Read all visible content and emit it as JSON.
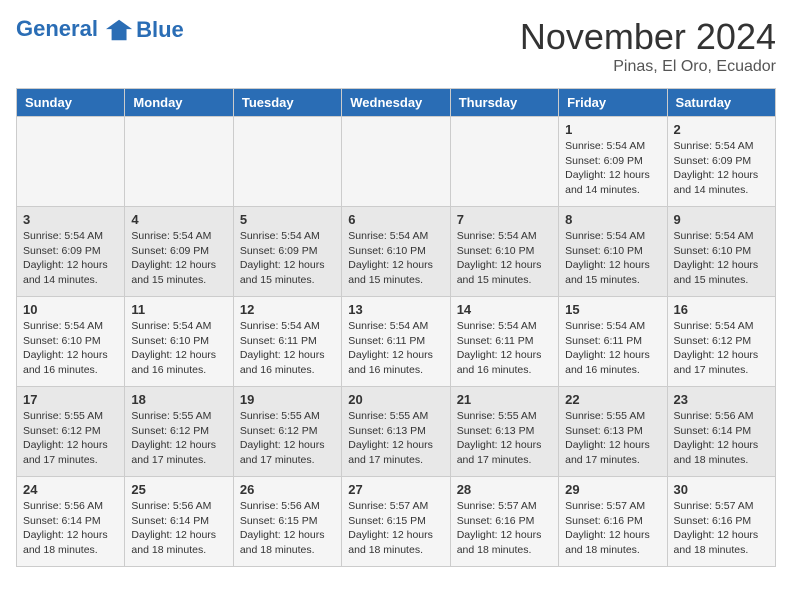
{
  "header": {
    "logo_line1": "General",
    "logo_line2": "Blue",
    "month": "November 2024",
    "location": "Pinas, El Oro, Ecuador"
  },
  "days_of_week": [
    "Sunday",
    "Monday",
    "Tuesday",
    "Wednesday",
    "Thursday",
    "Friday",
    "Saturday"
  ],
  "weeks": [
    [
      {
        "day": "",
        "info": ""
      },
      {
        "day": "",
        "info": ""
      },
      {
        "day": "",
        "info": ""
      },
      {
        "day": "",
        "info": ""
      },
      {
        "day": "",
        "info": ""
      },
      {
        "day": "1",
        "info": "Sunrise: 5:54 AM\nSunset: 6:09 PM\nDaylight: 12 hours and 14 minutes."
      },
      {
        "day": "2",
        "info": "Sunrise: 5:54 AM\nSunset: 6:09 PM\nDaylight: 12 hours and 14 minutes."
      }
    ],
    [
      {
        "day": "3",
        "info": "Sunrise: 5:54 AM\nSunset: 6:09 PM\nDaylight: 12 hours and 14 minutes."
      },
      {
        "day": "4",
        "info": "Sunrise: 5:54 AM\nSunset: 6:09 PM\nDaylight: 12 hours and 15 minutes."
      },
      {
        "day": "5",
        "info": "Sunrise: 5:54 AM\nSunset: 6:09 PM\nDaylight: 12 hours and 15 minutes."
      },
      {
        "day": "6",
        "info": "Sunrise: 5:54 AM\nSunset: 6:10 PM\nDaylight: 12 hours and 15 minutes."
      },
      {
        "day": "7",
        "info": "Sunrise: 5:54 AM\nSunset: 6:10 PM\nDaylight: 12 hours and 15 minutes."
      },
      {
        "day": "8",
        "info": "Sunrise: 5:54 AM\nSunset: 6:10 PM\nDaylight: 12 hours and 15 minutes."
      },
      {
        "day": "9",
        "info": "Sunrise: 5:54 AM\nSunset: 6:10 PM\nDaylight: 12 hours and 15 minutes."
      }
    ],
    [
      {
        "day": "10",
        "info": "Sunrise: 5:54 AM\nSunset: 6:10 PM\nDaylight: 12 hours and 16 minutes."
      },
      {
        "day": "11",
        "info": "Sunrise: 5:54 AM\nSunset: 6:10 PM\nDaylight: 12 hours and 16 minutes."
      },
      {
        "day": "12",
        "info": "Sunrise: 5:54 AM\nSunset: 6:11 PM\nDaylight: 12 hours and 16 minutes."
      },
      {
        "day": "13",
        "info": "Sunrise: 5:54 AM\nSunset: 6:11 PM\nDaylight: 12 hours and 16 minutes."
      },
      {
        "day": "14",
        "info": "Sunrise: 5:54 AM\nSunset: 6:11 PM\nDaylight: 12 hours and 16 minutes."
      },
      {
        "day": "15",
        "info": "Sunrise: 5:54 AM\nSunset: 6:11 PM\nDaylight: 12 hours and 16 minutes."
      },
      {
        "day": "16",
        "info": "Sunrise: 5:54 AM\nSunset: 6:12 PM\nDaylight: 12 hours and 17 minutes."
      }
    ],
    [
      {
        "day": "17",
        "info": "Sunrise: 5:55 AM\nSunset: 6:12 PM\nDaylight: 12 hours and 17 minutes."
      },
      {
        "day": "18",
        "info": "Sunrise: 5:55 AM\nSunset: 6:12 PM\nDaylight: 12 hours and 17 minutes."
      },
      {
        "day": "19",
        "info": "Sunrise: 5:55 AM\nSunset: 6:12 PM\nDaylight: 12 hours and 17 minutes."
      },
      {
        "day": "20",
        "info": "Sunrise: 5:55 AM\nSunset: 6:13 PM\nDaylight: 12 hours and 17 minutes."
      },
      {
        "day": "21",
        "info": "Sunrise: 5:55 AM\nSunset: 6:13 PM\nDaylight: 12 hours and 17 minutes."
      },
      {
        "day": "22",
        "info": "Sunrise: 5:55 AM\nSunset: 6:13 PM\nDaylight: 12 hours and 17 minutes."
      },
      {
        "day": "23",
        "info": "Sunrise: 5:56 AM\nSunset: 6:14 PM\nDaylight: 12 hours and 18 minutes."
      }
    ],
    [
      {
        "day": "24",
        "info": "Sunrise: 5:56 AM\nSunset: 6:14 PM\nDaylight: 12 hours and 18 minutes."
      },
      {
        "day": "25",
        "info": "Sunrise: 5:56 AM\nSunset: 6:14 PM\nDaylight: 12 hours and 18 minutes."
      },
      {
        "day": "26",
        "info": "Sunrise: 5:56 AM\nSunset: 6:15 PM\nDaylight: 12 hours and 18 minutes."
      },
      {
        "day": "27",
        "info": "Sunrise: 5:57 AM\nSunset: 6:15 PM\nDaylight: 12 hours and 18 minutes."
      },
      {
        "day": "28",
        "info": "Sunrise: 5:57 AM\nSunset: 6:16 PM\nDaylight: 12 hours and 18 minutes."
      },
      {
        "day": "29",
        "info": "Sunrise: 5:57 AM\nSunset: 6:16 PM\nDaylight: 12 hours and 18 minutes."
      },
      {
        "day": "30",
        "info": "Sunrise: 5:57 AM\nSunset: 6:16 PM\nDaylight: 12 hours and 18 minutes."
      }
    ]
  ]
}
